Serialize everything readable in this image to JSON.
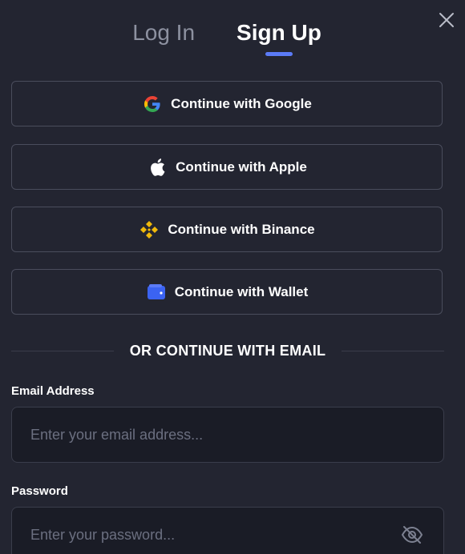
{
  "tabs": {
    "login_label": "Log In",
    "signup_label": "Sign Up",
    "active": "signup"
  },
  "oauth": {
    "google_label": "Continue with Google",
    "apple_label": "Continue with Apple",
    "binance_label": "Continue with Binance",
    "wallet_label": "Continue with Wallet"
  },
  "divider": {
    "text": "OR CONTINUE WITH EMAIL"
  },
  "email": {
    "label": "Email Address",
    "placeholder": "Enter your email address...",
    "value": ""
  },
  "password": {
    "label": "Password",
    "placeholder": "Enter your password...",
    "value": ""
  },
  "icons": {
    "close": "close-icon",
    "google": "google-icon",
    "apple": "apple-icon",
    "binance": "binance-icon",
    "wallet": "wallet-icon",
    "eye_off": "eye-off-icon"
  },
  "colors": {
    "background": "#232531",
    "accent": "#5b7bf7",
    "binance": "#f0b90b",
    "wallet": "#3b63f2",
    "border": "#4a4d5c",
    "input_bg": "#1a1c26",
    "muted_text": "#8d91a0"
  }
}
